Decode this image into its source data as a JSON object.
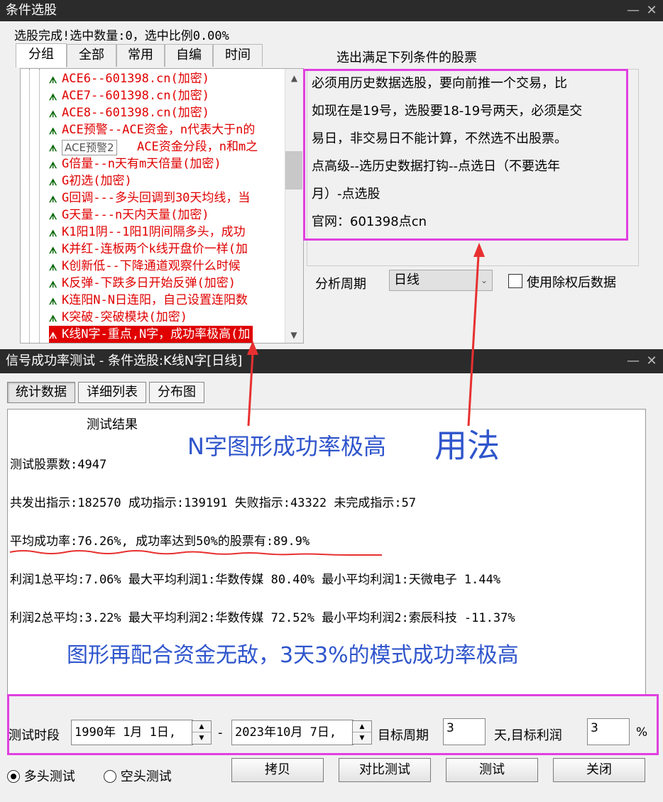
{
  "window1": {
    "title": "条件选股",
    "status": "选股完成!选中数量:0，选中比例0.00%",
    "tabs": [
      "分组",
      "全部",
      "常用",
      "自编",
      "时间"
    ],
    "tree_items": [
      "ACE6--601398.cn(加密)",
      "ACE7--601398.cn(加密)",
      "ACE8--601398.cn(加密)",
      "ACE预警--ACE资金，n代表大于n的",
      "ACE资金分段，n和m之",
      "G倍量--n天有m天倍量(加密)",
      "G初选(加密)",
      "G回调---多头回调到30天均线，当",
      "G天量---n天内天量(加密)",
      "K1阳1阴--1阳1阴间隔多头，成功",
      "K并红-连板两个k线开盘价一样(加",
      "K创新低--下降通道观察什么时候",
      "K反弹-下跌多日开始反弹(加密)",
      "K连阳N-N日连阳，自己设置连阳数",
      "K突破-突破模块(加密)",
      "K线N字-重点,N字，成功率极高(加"
    ],
    "tooltip": "ACE预警2",
    "conditions_title": "选出满足下列条件的股票",
    "desc_lines": [
      "必须用历史数据选股，要向前推一个交易，比",
      "如现在是19号，选股要18-19号两天，必须是交",
      "易日，非交易日不能计算，不然选不出股票。",
      "点高级--选历史数据打钩--点选日（不要选年",
      "月）-点选股",
      "官网：601398点cn"
    ],
    "period_label": "分析周期",
    "period_value": "日线",
    "exright_label": "使用除权后数据"
  },
  "window2": {
    "title": "信号成功率测试 - 条件选股:K线N字[日线]",
    "tabs": [
      "统计数据",
      "详细列表",
      "分布图"
    ],
    "result_title": "测试结果",
    "line1": "测试股票数:4947",
    "line2": "共发出指示:182570 成功指示:139191 失败指示:43322 未完成指示:57",
    "line3": "平均成功率:76.26%, 成功率达到50%的股票有:89.9%",
    "line4": "利润1总平均:7.06% 最大平均利润1:华数传媒 80.40% 最小平均利润1:天微电子 1.44%",
    "line5": "利润2总平均:3.22% 最大平均利润2:华数传媒 72.52% 最小平均利润2:索辰科技 -11.37%",
    "period_label": "测试时段",
    "start_date": "1990年 1月 1日,",
    "dash": "-",
    "end_date": "2023年10月 7日,",
    "target_period_label": "目标周期",
    "target_period_value": "3",
    "days_label": "天,目标利润",
    "target_profit_value": "3",
    "percent": "%",
    "long_label": "多头测试",
    "short_label": "空头测试",
    "buttons": [
      "拷贝",
      "对比测试",
      "测试",
      "关闭"
    ]
  },
  "annotations": {
    "n_shape": "N字图形成功率极高",
    "usage": "用法",
    "bottom": "图形再配合资金无敌，3天3%的模式成功率极高"
  },
  "colors": {
    "annotation": "#2f55cc",
    "highlight": "#e040e0",
    "arrow": "#e83030",
    "tree_text": "#e00000"
  }
}
